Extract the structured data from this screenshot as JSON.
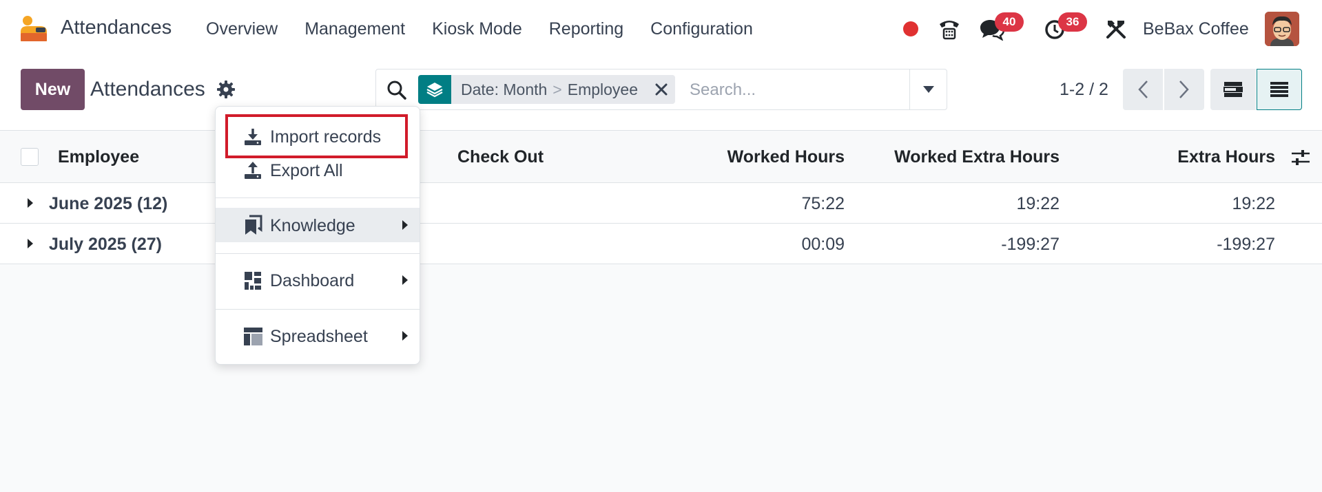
{
  "app": {
    "name": "Attendances"
  },
  "nav": {
    "menu": [
      "Overview",
      "Management",
      "Kiosk Mode",
      "Reporting",
      "Configuration"
    ],
    "messages_badge": "40",
    "activities_badge": "36",
    "company": "BeBax Coffee"
  },
  "control": {
    "new_label": "New",
    "title": "Attendances",
    "facet": {
      "field": "Date: Month",
      "separator": ">",
      "value": "Employee"
    },
    "search_placeholder": "Search...",
    "pager": "1-2 / 2"
  },
  "list": {
    "columns": {
      "employee": "Employee",
      "check_out": "Check Out",
      "worked_hours": "Worked Hours",
      "worked_extra_hours": "Worked Extra Hours",
      "extra_hours": "Extra Hours"
    },
    "groups": [
      {
        "label": "June 2025 (12)",
        "worked_hours": "75:22",
        "worked_extra_hours": "19:22",
        "extra_hours": "19:22"
      },
      {
        "label": "July 2025 (27)",
        "worked_hours": "00:09",
        "worked_extra_hours": "-199:27",
        "extra_hours": "-199:27"
      }
    ]
  },
  "dropdown": {
    "import": "Import records",
    "export": "Export All",
    "knowledge": "Knowledge",
    "dashboard": "Dashboard",
    "spreadsheet": "Spreadsheet"
  },
  "colors": {
    "brand": "#714b67",
    "accent": "#017e84",
    "badge": "#dc3545",
    "highlight": "#d11b2a"
  }
}
